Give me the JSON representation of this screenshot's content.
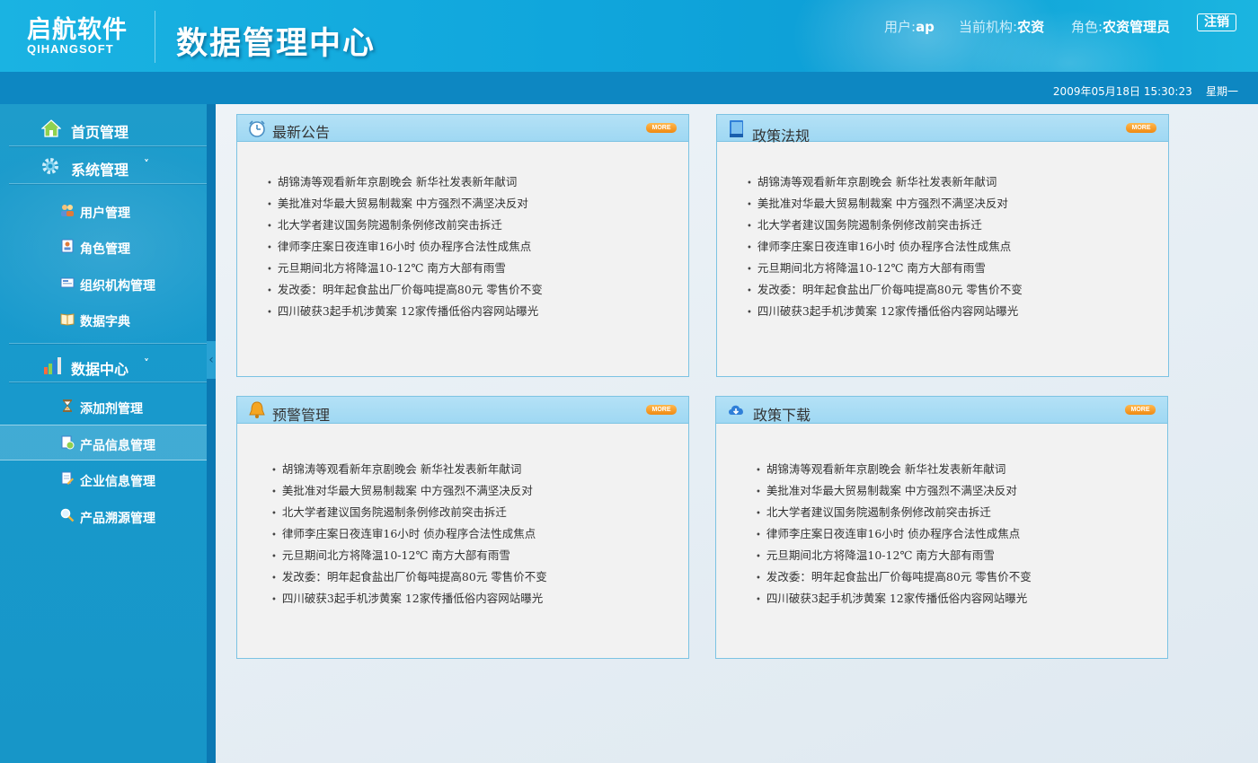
{
  "header": {
    "logo_cn": "启航软件",
    "logo_en": "QIHANGSOFT",
    "app_title": "数据管理中心",
    "user_label": "用户:",
    "user_value": "ap",
    "org_label": "当前机构:",
    "org_value": "农资",
    "role_label": "角色:",
    "role_value": "农资管理员",
    "logout_label": "注销",
    "datetime": "2009年05月18日 15:30:23",
    "weekday": "星期一"
  },
  "sidebar": {
    "sections": [
      {
        "label": "首页管理",
        "icon": "home-icon"
      },
      {
        "label": "系统管理",
        "icon": "gear-icon",
        "chevron": "˅"
      },
      {
        "label": "数据中心",
        "icon": "bar-chart-icon",
        "chevron": "˅"
      }
    ],
    "system_items": [
      {
        "label": "用户管理",
        "icon": "users-icon"
      },
      {
        "label": "角色管理",
        "icon": "role-card-icon"
      },
      {
        "label": "组织机构管理",
        "icon": "org-icon"
      },
      {
        "label": "数据字典",
        "icon": "book-icon"
      }
    ],
    "data_items": [
      {
        "label": "添加剂管理",
        "icon": "hourglass-icon"
      },
      {
        "label": "产品信息管理",
        "icon": "product-doc-icon",
        "active": true
      },
      {
        "label": "企业信息管理",
        "icon": "edit-doc-icon"
      },
      {
        "label": "产品溯源管理",
        "icon": "magnifier-icon"
      }
    ]
  },
  "panels": [
    {
      "title": "最新公告",
      "icon": "clock-icon",
      "more": "MORE"
    },
    {
      "title": "政策法规",
      "icon": "book-blue-icon",
      "more": "MORE"
    },
    {
      "title": "预警管理",
      "icon": "bell-icon",
      "more": "MORE"
    },
    {
      "title": "政策下载",
      "icon": "cloud-download-icon",
      "more": "MORE"
    }
  ],
  "news_items": [
    "胡锦涛等观看新年京剧晚会  新华社发表新年献词",
    "美批准对华最大贸易制裁案  中方强烈不满坚决反对",
    "北大学者建议国务院遏制条例修改前突击拆迁",
    "律师李庄案日夜连审16小时  侦办程序合法性成焦点",
    "元旦期间北方将降温10-12℃  南方大部有雨雪",
    "发改委：明年起食盐出厂价每吨提高80元  零售价不变",
    "四川破获3起手机涉黄案  12家传播低俗内容网站曝光"
  ],
  "colors": {
    "header": "#10a6dc",
    "sidebar": "#1998cb",
    "panel_border": "#7cc3e3",
    "more_badge": "#f08a12"
  }
}
